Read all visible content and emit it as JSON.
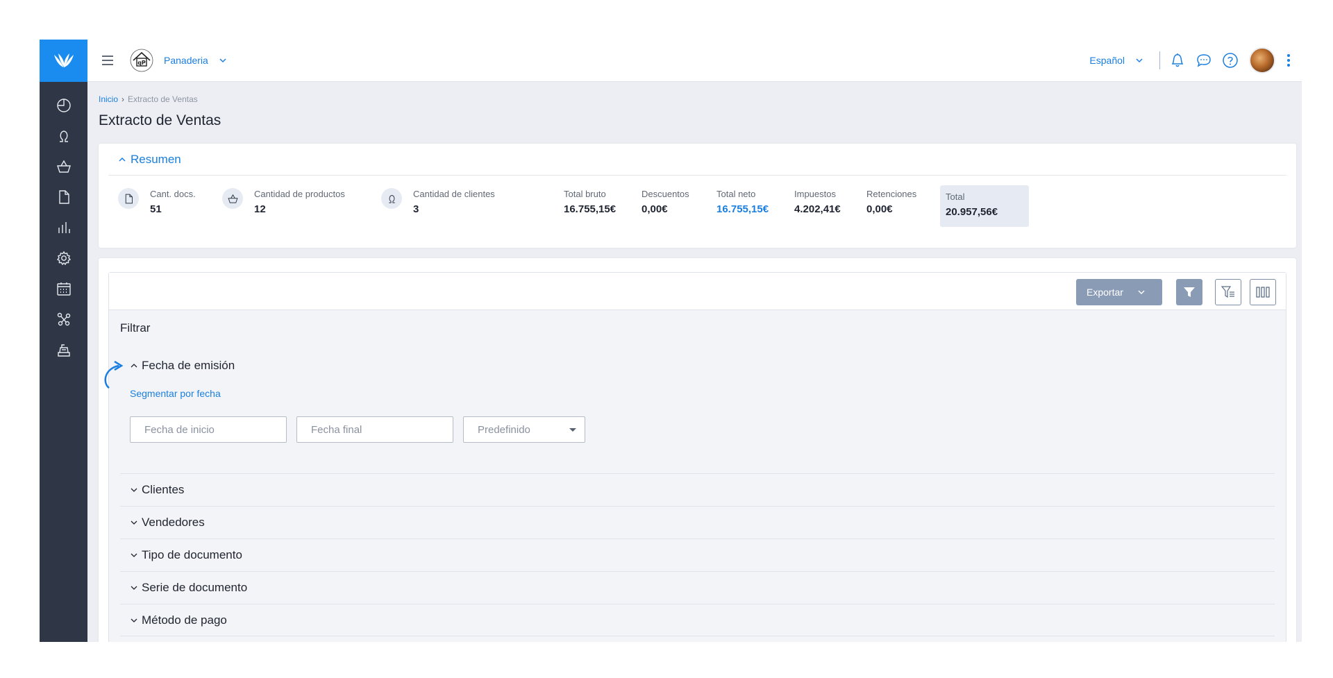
{
  "topbar": {
    "store_name": "Panaderia",
    "language": "Español"
  },
  "breadcrumb": {
    "home": "Inicio",
    "separator": "›",
    "current": "Extracto de Ventas"
  },
  "page_title": "Extracto de Ventas",
  "summary": {
    "header": "Resumen",
    "stats": [
      {
        "label": "Cant. docs.",
        "value": "51",
        "icon": "document-icon"
      },
      {
        "label": "Cantidad de productos",
        "value": "12",
        "icon": "basket-icon"
      },
      {
        "label": "Cantidad de clientes",
        "value": "3",
        "icon": "person-icon"
      },
      {
        "label": "Total bruto",
        "value": "16.755,15€"
      },
      {
        "label": "Descuentos",
        "value": "0,00€"
      },
      {
        "label": "Total neto",
        "value": "16.755,15€"
      },
      {
        "label": "Impuestos",
        "value": "4.202,41€"
      },
      {
        "label": "Retenciones",
        "value": "0,00€"
      },
      {
        "label": "Total",
        "value": "20.957,56€"
      }
    ]
  },
  "toolbar": {
    "export_label": "Exportar"
  },
  "filters": {
    "title": "Filtrar",
    "open_section": "Fecha de emisión",
    "segment_link": "Segmentar por fecha",
    "start_placeholder": "Fecha de inicio",
    "end_placeholder": "Fecha final",
    "preset_value": "Predefinido",
    "sections": [
      "Clientes",
      "Vendedores",
      "Tipo de documento",
      "Serie de documento",
      "Método de pago"
    ]
  },
  "colors": {
    "accent": "#1a8cf0",
    "sidebar": "#2f3747",
    "button": "#8a9bb6"
  }
}
